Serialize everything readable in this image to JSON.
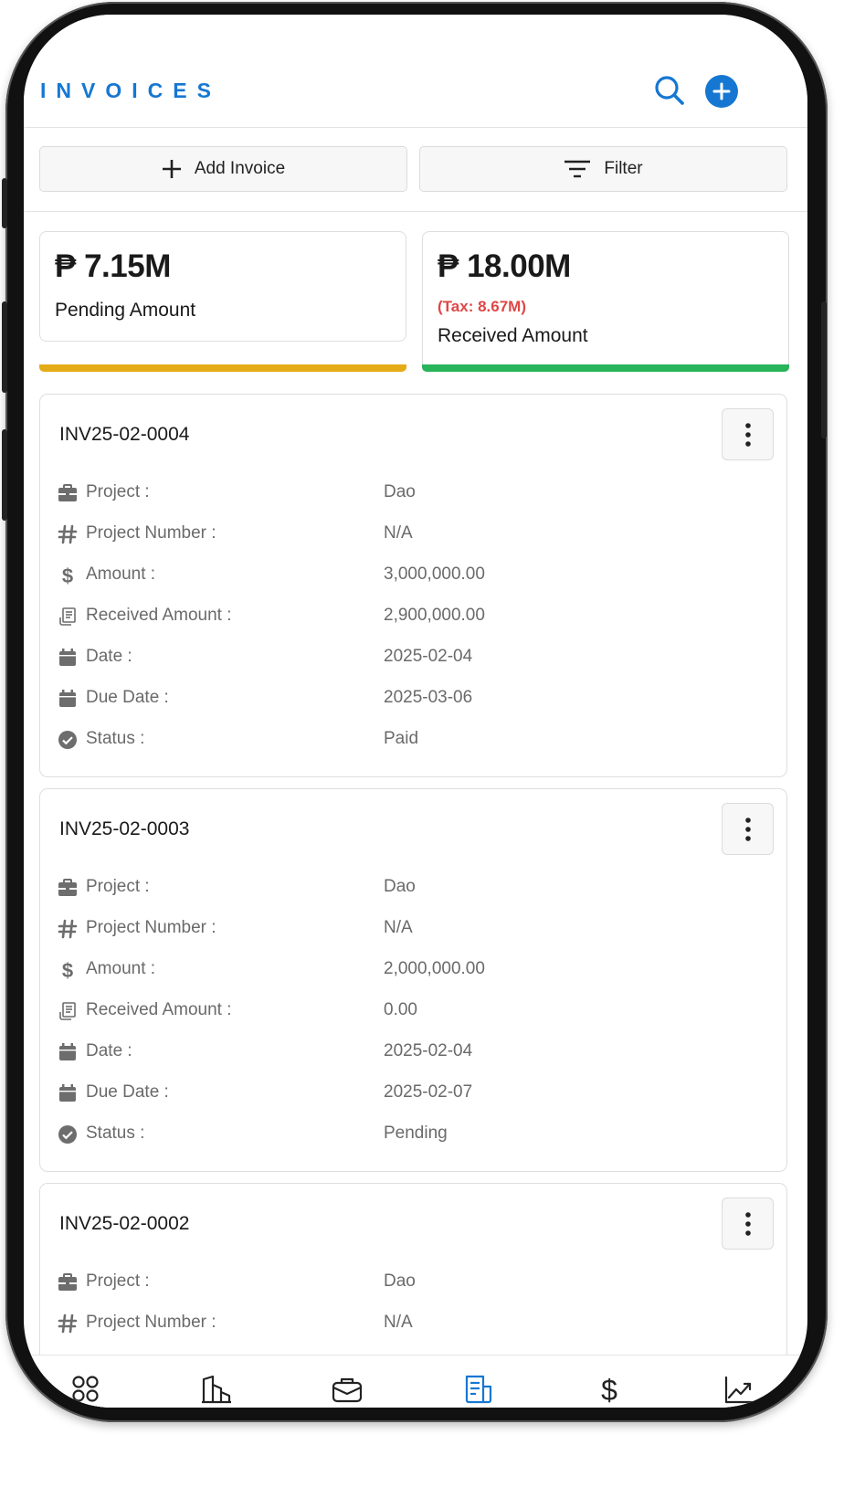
{
  "header": {
    "title": "INVOICES",
    "search_icon": "search-icon",
    "add_icon": "plus-circle-icon"
  },
  "actions": {
    "add_label": "Add Invoice",
    "filter_label": "Filter"
  },
  "summary": {
    "pending": {
      "amount": "₱ 7.15M",
      "label": "Pending Amount",
      "bar_color": "#e5ab17"
    },
    "received": {
      "amount": "₱ 18.00M",
      "tax": "(Tax: 8.67M)",
      "label": "Received Amount",
      "bar_color": "#27b45a"
    }
  },
  "field_labels": {
    "project": "Project :",
    "project_number": "Project Number :",
    "amount": "Amount :",
    "received_amount": "Received Amount :",
    "date": "Date :",
    "due_date": "Due Date :",
    "status": "Status :"
  },
  "invoices": [
    {
      "id": "INV25-02-0004",
      "project": "Dao",
      "project_number": "N/A",
      "amount": "3,000,000.00",
      "received_amount": "2,900,000.00",
      "date": "2025-02-04",
      "due_date": "2025-03-06",
      "status": "Paid"
    },
    {
      "id": "INV25-02-0003",
      "project": "Dao",
      "project_number": "N/A",
      "amount": "2,000,000.00",
      "received_amount": "0.00",
      "date": "2025-02-04",
      "due_date": "2025-02-07",
      "status": "Pending"
    },
    {
      "id": "INV25-02-0002",
      "project": "Dao",
      "project_number": "N/A"
    }
  ],
  "bottom_nav": [
    {
      "icon": "dashboard-grid-icon",
      "active": false
    },
    {
      "icon": "projects-building-icon",
      "active": false
    },
    {
      "icon": "briefcase-icon",
      "active": false
    },
    {
      "icon": "invoice-document-icon",
      "active": true
    },
    {
      "icon": "dollar-icon",
      "active": false
    },
    {
      "icon": "trending-chart-icon",
      "active": false
    }
  ],
  "colors": {
    "accent": "#1677d2",
    "pending": "#e5ab17",
    "received": "#27b45a",
    "tax": "#e04646"
  }
}
